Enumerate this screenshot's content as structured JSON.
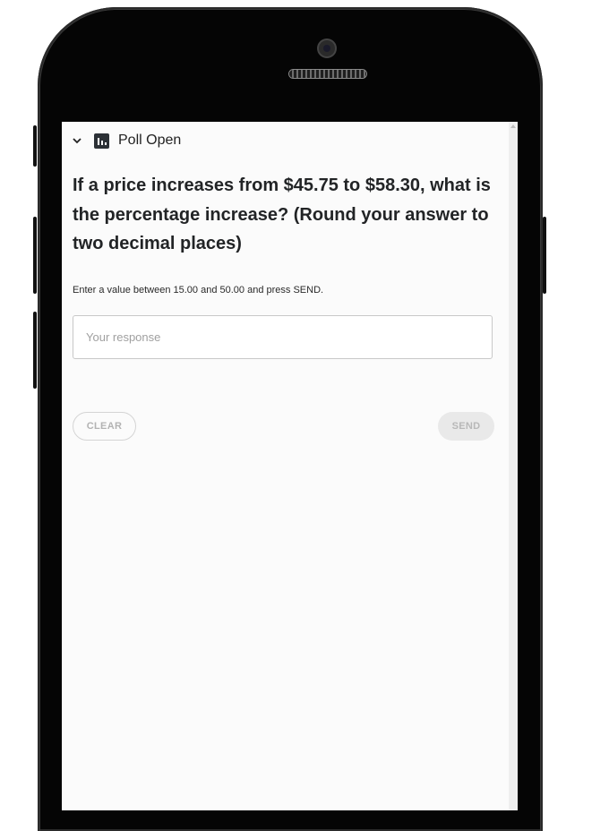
{
  "poll": {
    "status_label": "Poll Open",
    "question": "If a price increases from $45.75 to $58.30, what is the percentage increase? (Round your answer to two decimal places)",
    "instruction": "Enter a value between 15.00 and 50.00 and press SEND.",
    "response": {
      "value": "",
      "placeholder": "Your response"
    },
    "buttons": {
      "clear_label": "CLEAR",
      "send_label": "SEND"
    }
  },
  "icons": {
    "collapse": "chevron-down-icon",
    "poll": "bar-chart-icon"
  },
  "colors": {
    "background": "#fbfbfb",
    "question_text": "#222426",
    "icon": "#2c3136",
    "button_disabled_text": "#b8b8b8",
    "send_button_bg": "#e9e9e9"
  }
}
